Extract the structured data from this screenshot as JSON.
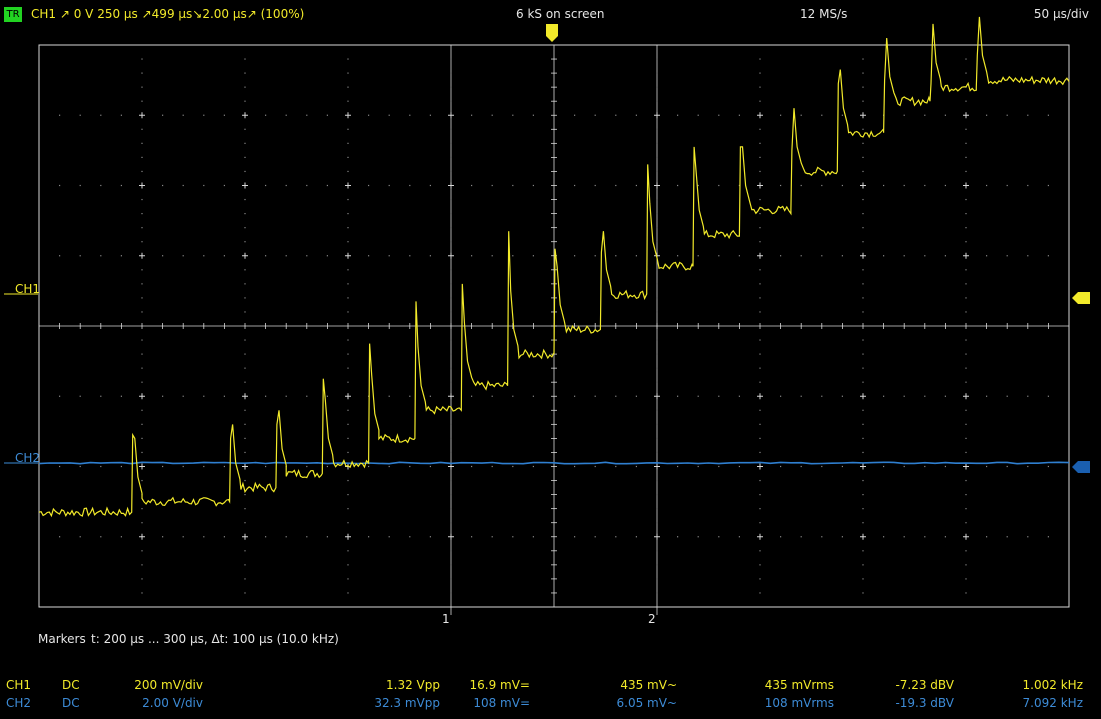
{
  "header": {
    "trigger_badge": "TR",
    "trigger_info": "CH1  ↗  0 V  250 µs  ↗499 µs↘2.00 µs↗ (100%)",
    "samples": "6 kS on screen",
    "sample_rate": "12 MS/s",
    "timebase": "50 µs/div"
  },
  "channel_labels": {
    "ch1": "CH1",
    "ch2": "CH2"
  },
  "markers": {
    "label": "Markers",
    "text": "t: 200 µs ... 300 µs,  Δt: 100 µs (10.0 kHz)",
    "marker1": "1",
    "marker2": "2"
  },
  "measurements": [
    {
      "channel": "CH1",
      "coupling": "DC",
      "scale": "200 mV/div",
      "vpp": "1.32 Vpp",
      "vdc": "16.9 mV=",
      "vac": "435 mV~",
      "vrms": "435 mVrms",
      "dbv": "-7.23 dBV",
      "freq": "1.002 kHz"
    },
    {
      "channel": "CH2",
      "coupling": "DC",
      "scale": "2.00 V/div",
      "vpp": "32.3 mVpp",
      "vdc": "108 mV=",
      "vac": "6.05 mV~",
      "vrms": "108 mVrms",
      "dbv": "-19.3 dBV",
      "freq": "7.092 kHz"
    }
  ],
  "colors": {
    "ch1": "#f2ea2a",
    "ch2": "#3d8bd6",
    "grid": "#d8d8d8",
    "trigger": "#22d322"
  },
  "chart_data": {
    "type": "line",
    "title": "",
    "xlabel": "",
    "ylabel": "",
    "x_unit": "div",
    "y_unit": "div",
    "xlim": [
      0,
      10
    ],
    "ylim": [
      -4,
      4
    ],
    "grid": true,
    "series": [
      {
        "name": "CH1",
        "step_x": [
          0.9,
          1.85,
          2.3,
          2.75,
          3.2,
          3.65,
          4.1,
          4.55,
          5.0,
          5.45,
          5.9,
          6.35,
          6.8,
          7.3,
          7.75,
          8.2,
          8.65,
          9.1
        ],
        "step_levels": [
          -2.65,
          -2.5,
          -2.3,
          -2.1,
          -1.95,
          -1.6,
          -1.2,
          -0.85,
          -0.4,
          -0.05,
          0.45,
          0.85,
          1.3,
          1.65,
          2.2,
          2.75,
          3.2,
          3.4,
          3.5
        ],
        "spike_peaks": [
          -1.55,
          -1.6,
          -1.4,
          -0.75,
          -0.25,
          0.35,
          0.6,
          1.35,
          1.1,
          1.05,
          2.3,
          2.55,
          2.55,
          2.5,
          3.45,
          3.5,
          3.45,
          3.85
        ]
      },
      {
        "name": "CH2",
        "x": [
          0,
          10
        ],
        "y": [
          -1.95,
          -1.95
        ]
      }
    ]
  }
}
